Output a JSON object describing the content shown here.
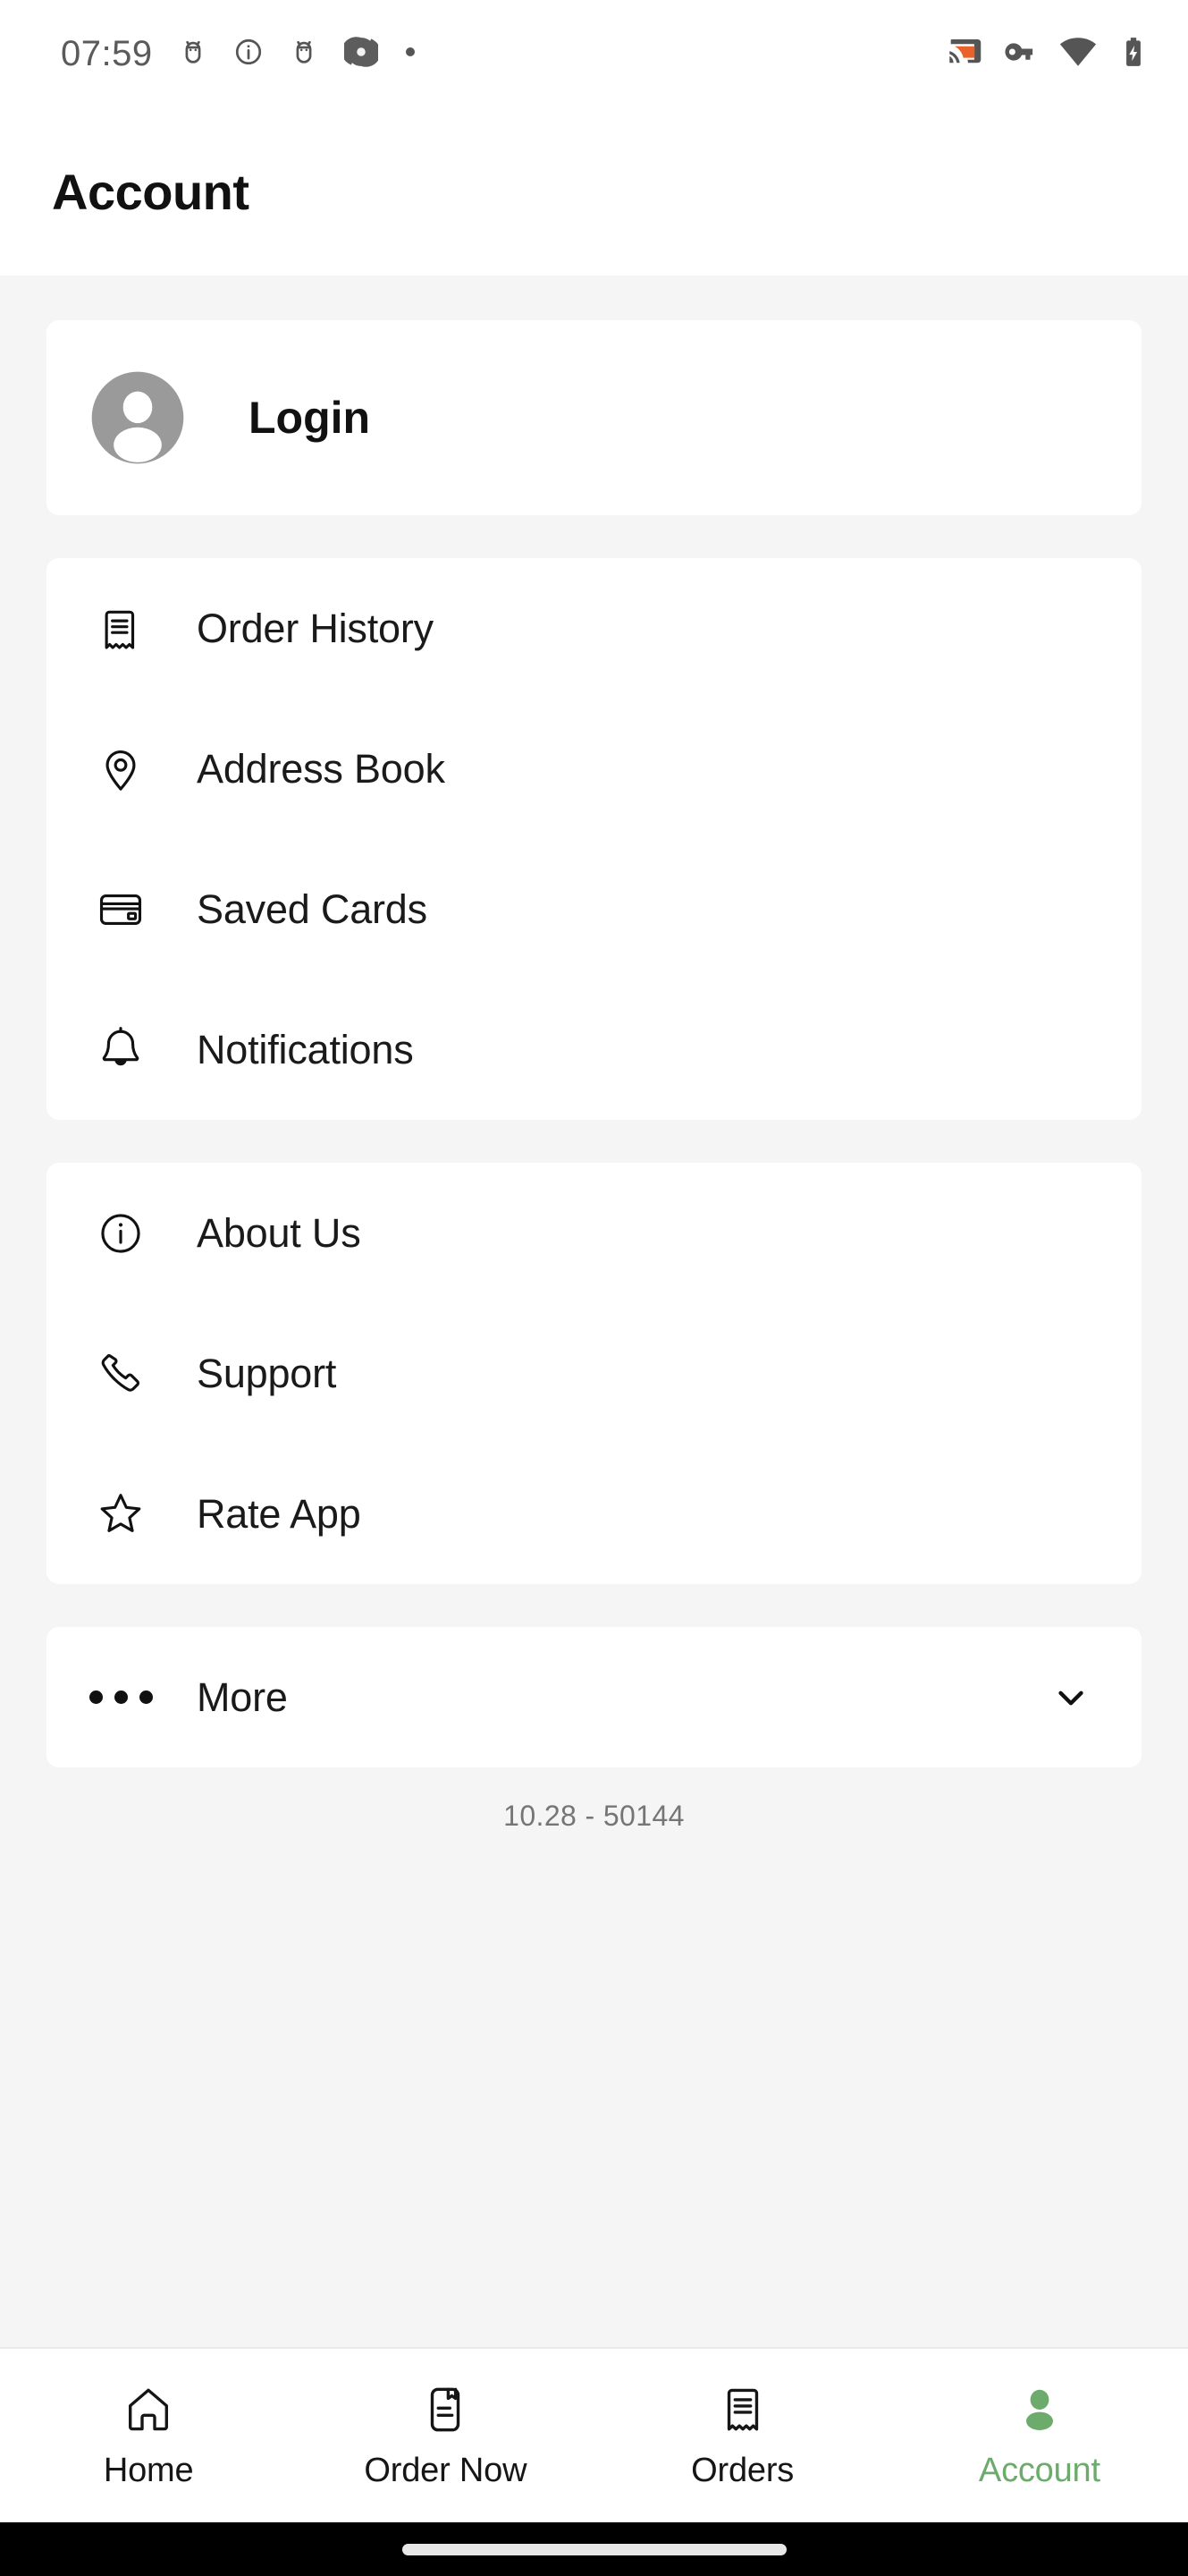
{
  "status_bar": {
    "time": "07:59",
    "left_icons": [
      "android-bot-icon",
      "info-circle-icon",
      "android-bot-icon",
      "shutter-app-icon",
      "dot-icon"
    ],
    "right_icons": [
      "cast-icon",
      "vpn-key-icon",
      "wifi-icon",
      "battery-charging-icon"
    ],
    "cast_accent_color": "#E8622A",
    "icon_color": "#555555"
  },
  "header": {
    "title": "Account"
  },
  "login_card": {
    "label": "Login",
    "avatar_icon": "person-avatar-icon",
    "avatar_color": "#9a9a9a"
  },
  "account_group": {
    "items": [
      {
        "label": "Order History",
        "icon": "receipt-icon"
      },
      {
        "label": "Address Book",
        "icon": "location-pin-icon"
      },
      {
        "label": "Saved Cards",
        "icon": "credit-card-icon"
      },
      {
        "label": "Notifications",
        "icon": "bell-icon"
      }
    ]
  },
  "info_group": {
    "items": [
      {
        "label": "About Us",
        "icon": "info-circle-icon"
      },
      {
        "label": "Support",
        "icon": "phone-icon"
      },
      {
        "label": "Rate App",
        "icon": "star-outline-icon"
      }
    ]
  },
  "more_row": {
    "label": "More",
    "icon": "ellipsis-icon",
    "chevron": "chevron-down-icon",
    "expanded": false
  },
  "version": {
    "text": "10.28 - 50144"
  },
  "bottom_nav": {
    "active_color": "#6CAB6C",
    "inactive_color": "#161616",
    "items": [
      {
        "label": "Home",
        "icon": "home-icon",
        "active": false
      },
      {
        "label": "Order Now",
        "icon": "menu-card-icon",
        "active": false
      },
      {
        "label": "Orders",
        "icon": "receipt-icon",
        "active": false
      },
      {
        "label": "Account",
        "icon": "person-icon",
        "active": true
      }
    ]
  }
}
